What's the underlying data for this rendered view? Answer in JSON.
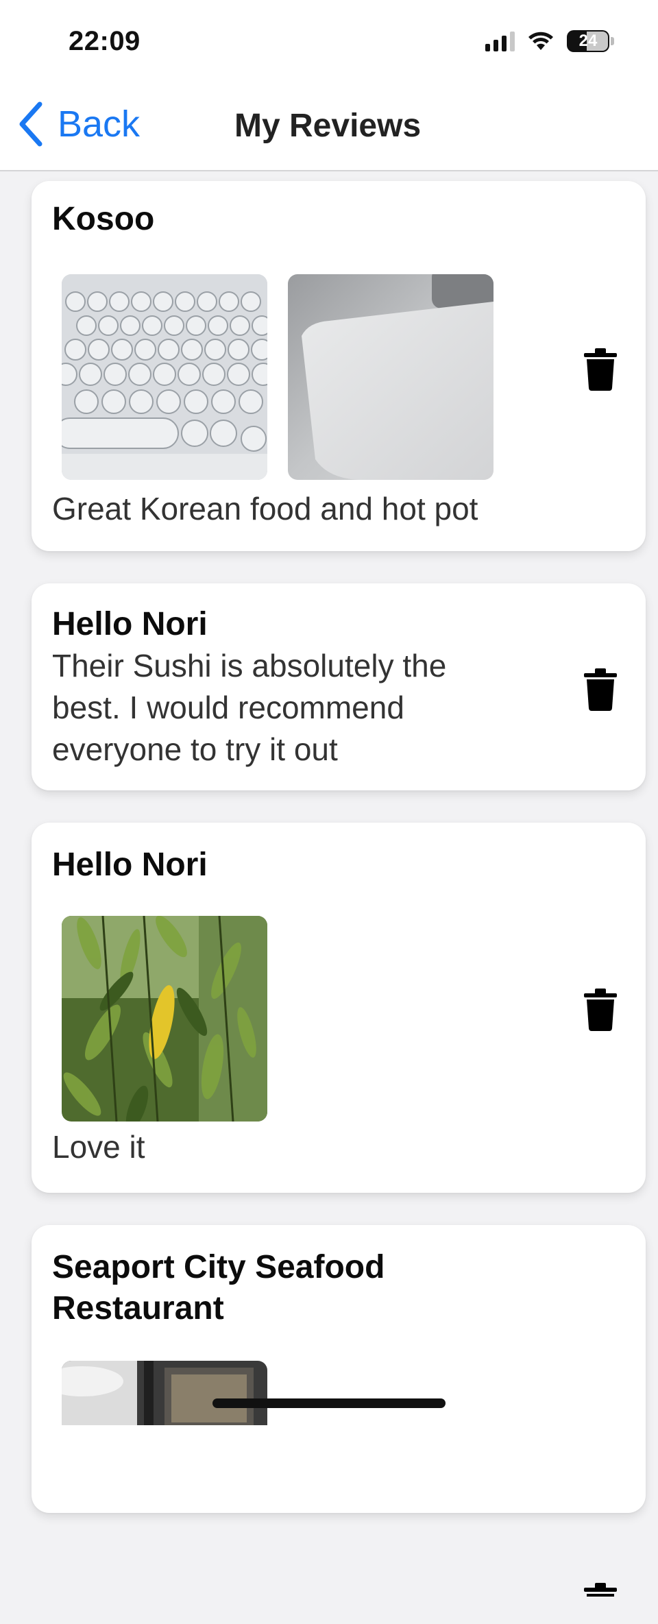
{
  "status_bar": {
    "time": "22:09",
    "battery": "24"
  },
  "nav": {
    "back_label": "Back",
    "title": "My Reviews"
  },
  "reviews": [
    {
      "title": "Kosoo",
      "text": "Great Korean food and hot pot",
      "photos": [
        "keyboard-photo",
        "trackpad-photo"
      ]
    },
    {
      "title": "Hello Nori",
      "text_lines": [
        "Their Sushi is absolutely the",
        "best. I would recommend",
        "everyone to try it out"
      ],
      "photos": []
    },
    {
      "title": "Hello Nori",
      "text": "Love it",
      "photos": [
        "plant-photo"
      ]
    },
    {
      "title_lines": [
        "Seaport City Seafood",
        "Restaurant"
      ],
      "photos": [
        "restaurant-photo"
      ]
    }
  ],
  "icons": {
    "delete": "trash-icon",
    "back": "chevron-left-icon"
  },
  "colors": {
    "accent": "#1a78f2",
    "card_bg": "#ffffff",
    "page_bg": "#f2f2f4"
  }
}
